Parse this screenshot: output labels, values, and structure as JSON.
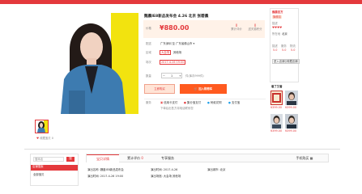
{
  "product": {
    "title": "魏晨IE8新品发布会 4.26 北京 张碧晨",
    "price_label": "价格",
    "price": "¥880.00",
    "stats": [
      {
        "value": "0",
        "label": "累计评价"
      },
      {
        "value": "0",
        "label": "送天猫积分"
      }
    ],
    "delivery_label": "配送",
    "delivery_value": "广东深圳 至 广东省佛山市 ▾",
    "location_label": "区域",
    "locations": [
      "大会场",
      "其他场"
    ],
    "time_label": "场次",
    "time_value": "2017-4-26 19:00",
    "quantity_label": "数量",
    "quantity": "1",
    "stock": "件(库存999件)",
    "buy_now": "立即购买",
    "add_cart": "加入购物车",
    "service_label": "服务",
    "services": [
      "信用卡支付",
      "集分宝支付",
      "蚂蚁花呗",
      "支付宝"
    ],
    "note": "下单后出售方将电话联系您",
    "favorite": "收藏宝贝",
    "favorite_count": "0"
  },
  "shop": {
    "name": "魏晨官方",
    "badge": "旗舰店",
    "rating_label": "描述",
    "location_label": "所在地",
    "location": "北京",
    "scores": [
      {
        "label": "描述",
        "value": "5.0"
      },
      {
        "label": "服务",
        "value": "5.0"
      },
      {
        "label": "物流",
        "value": "5.0"
      }
    ],
    "enter_shop": "进入店铺",
    "favorite_shop": "收藏店铺",
    "recommend_title": "看了又看",
    "prices": [
      "¥399.00",
      "¥399.00",
      "¥399.00",
      "¥399.00"
    ]
  },
  "bottom": {
    "search_placeholder": "搜本店",
    "search_button": "搜",
    "category_title": "店铺搜索",
    "category_items": [
      "全部宝贝"
    ],
    "tabs": [
      "宝贝详情",
      "累计评价",
      "专享服务"
    ],
    "tab_counts": [
      "",
      "0",
      ""
    ],
    "right_tab": "手机购买",
    "detail_rows": [
      [
        "演出名称: 魏晨IE8新品发布会",
        "演出时间: 2017-4-26",
        "演出城市: 北京"
      ],
      [
        "演出时间: 2017-4-26 19:00",
        "演出场馆: 大会场 其他场",
        ""
      ]
    ]
  },
  "colors": {
    "accent": "#e4393c",
    "orange": "#ff5a1f",
    "price_bg": "#fff2e8",
    "poster_yellow": "#f2e30f",
    "jacket_blue": "#3d7bb0"
  }
}
